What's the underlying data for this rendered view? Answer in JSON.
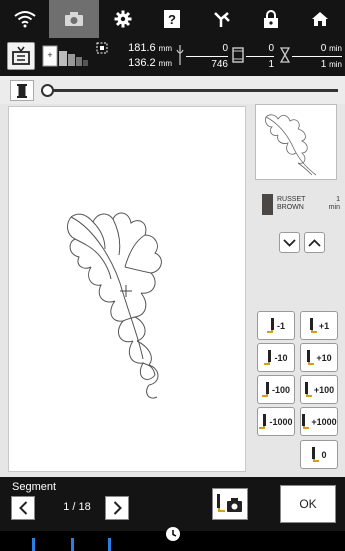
{
  "nav": {
    "items": [
      {
        "name": "wifi-icon"
      },
      {
        "name": "camera-icon",
        "active": true
      },
      {
        "name": "gear-icon"
      },
      {
        "name": "help-icon"
      },
      {
        "name": "needle-icon"
      },
      {
        "name": "lock-icon"
      },
      {
        "name": "home-icon"
      }
    ]
  },
  "status": {
    "width_value": "181.6",
    "height_value": "136.2",
    "unit": "mm",
    "stitch_current": "0",
    "stitch_total": "746",
    "color_current": "0",
    "color_total": "1",
    "time_current": "0",
    "time_total": "1",
    "time_unit": "min"
  },
  "thread": {
    "name_line1": "RUSSET",
    "name_line2": "BROWN",
    "time_value": "1",
    "time_unit": "min",
    "color": "#4a4744"
  },
  "stitch_buttons": {
    "minus1": "-1",
    "plus1": "+1",
    "minus10": "-10",
    "plus10": "+10",
    "minus100": "-100",
    "plus100": "+100",
    "minus1000": "-1000",
    "plus1000": "+1000",
    "zero": "0"
  },
  "segment": {
    "label": "Segment",
    "current": "1",
    "total": "18",
    "count_text": "1 / 18"
  },
  "ok_label": "OK",
  "colors": {
    "bar": "#141414",
    "active_tab": "#6f6f6f",
    "marker": "#2a7ee6"
  }
}
